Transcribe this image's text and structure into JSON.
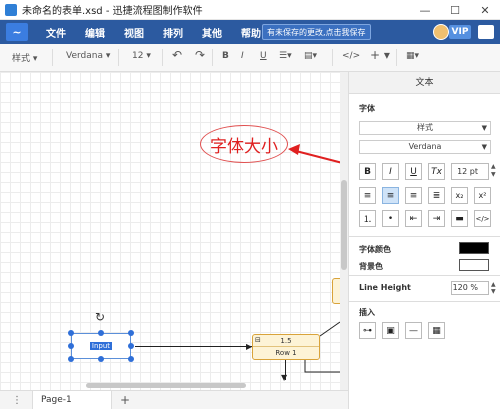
{
  "window": {
    "title": "未命名的表单.xsd - 迅捷流程图制作软件",
    "minimize_glyph": "—",
    "maximize_glyph": "☐",
    "close_glyph": "✕"
  },
  "menubar": {
    "items": [
      "文件",
      "编辑",
      "视图",
      "排列",
      "其他",
      "帮助"
    ],
    "notice": "有未保存的更改,点击我保存",
    "vip_label": "VIP",
    "accent_color": "#2c5aa0"
  },
  "toolbar": {
    "style_label": "样式",
    "font_family": "Verdana",
    "font_size": "12",
    "undo_icon": "undo-icon",
    "redo_icon": "redo-icon",
    "bold": "B",
    "italic": "I",
    "underline": "U",
    "clear": "Tx",
    "code": "</>",
    "add": "+"
  },
  "canvas": {
    "input_label": "Input",
    "row_node_value": "1.5",
    "row_node_label": "Row 1",
    "row_node_minus": "⊟",
    "annotation_text": "字体大小",
    "annotation_color": "#e02020"
  },
  "pages": {
    "tab_label": "Page-1",
    "add_label": "+"
  },
  "panel": {
    "title": "文本",
    "font_section": "字体",
    "style_select": "样式",
    "font_select": "Verdana",
    "bold": "B",
    "italic": "I",
    "underline": "U",
    "clear": "Tx",
    "font_size_value": "12 pt",
    "subscript": "x₂",
    "superscript": "x²",
    "code": "</>",
    "font_color_label": "字体颜色",
    "bg_color_label": "背景色",
    "font_color": "#000000",
    "bg_color": "#ffffff",
    "line_height_label": "Line Height",
    "line_height_value": "120 %",
    "insert_label": "插入"
  }
}
